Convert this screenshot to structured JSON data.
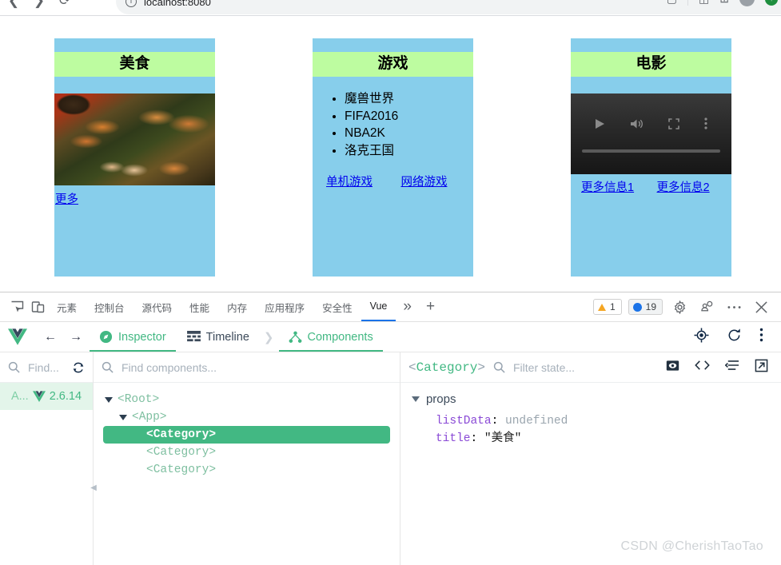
{
  "browser": {
    "url": "localhost:8080",
    "back_icon": "back-arrow-icon",
    "forward_icon": "forward-arrow-icon",
    "reload_icon": "reload-icon",
    "info_icon": "ⓘ"
  },
  "page": {
    "cards": [
      {
        "title": "美食",
        "type": "image",
        "links": [
          "更多"
        ]
      },
      {
        "title": "游戏",
        "type": "list",
        "items": [
          "魔兽世界",
          "FIFA2016",
          "NBA2K",
          "洛克王国"
        ],
        "links": [
          "单机游戏",
          "网络游戏"
        ]
      },
      {
        "title": "电影",
        "type": "video",
        "links": [
          "更多信息1",
          "更多信息2"
        ]
      }
    ],
    "colors": {
      "card_bg": "#87CEEB",
      "title_bg": "#BDFCA0",
      "link": "#0000EE"
    }
  },
  "devtools": {
    "tabs": [
      {
        "label": "元素",
        "active": false
      },
      {
        "label": "控制台",
        "active": false
      },
      {
        "label": "源代码",
        "active": false
      },
      {
        "label": "性能",
        "active": false
      },
      {
        "label": "内存",
        "active": false
      },
      {
        "label": "应用程序",
        "active": false
      },
      {
        "label": "安全性",
        "active": false
      },
      {
        "label": "Vue",
        "active": true
      }
    ],
    "more_tabs_label": "»",
    "add_tab_label": "+",
    "warnings_count": "1",
    "messages_count": "19",
    "settings_icon": "gear-icon",
    "devices_icon": "devices-icon",
    "more_icon": "more-options-icon",
    "close_icon": "close-icon"
  },
  "vue": {
    "tabs": [
      {
        "label": "Inspector",
        "icon": "compass-icon",
        "active": true
      },
      {
        "label": "Timeline",
        "icon": "timeline-icon",
        "active": false
      },
      {
        "label": "Components",
        "icon": "components-icon",
        "active": true
      }
    ],
    "toolbar_icons": [
      "target-icon",
      "refresh-icon",
      "vertical-dots-icon"
    ],
    "apps": {
      "search_placeholder": "Find...",
      "items": [
        {
          "label": "A...",
          "version": "2.6.14"
        }
      ]
    },
    "tree": {
      "search_placeholder": "Find components...",
      "nodes": [
        {
          "label": "<Root>",
          "depth": 0,
          "expanded": true,
          "selected": false
        },
        {
          "label": "<App>",
          "depth": 1,
          "expanded": true,
          "selected": false
        },
        {
          "label": "<Category>",
          "depth": 2,
          "expanded": false,
          "selected": true
        },
        {
          "label": "<Category>",
          "depth": 2,
          "expanded": false,
          "selected": false
        },
        {
          "label": "<Category>",
          "depth": 2,
          "expanded": false,
          "selected": false
        }
      ]
    },
    "state": {
      "component_open": "<",
      "component_name": "Category",
      "component_close": ">",
      "filter_placeholder": "Filter state...",
      "group_label": "props",
      "props": [
        {
          "key": "listData",
          "value": "undefined",
          "kind": "undefined"
        },
        {
          "key": "title",
          "value": "\"美食\"",
          "kind": "string"
        }
      ],
      "icons": [
        "preview-icon",
        "code-icon",
        "collapse-icon",
        "open-external-icon"
      ]
    }
  },
  "watermark": "CSDN @CherishTaoTao"
}
